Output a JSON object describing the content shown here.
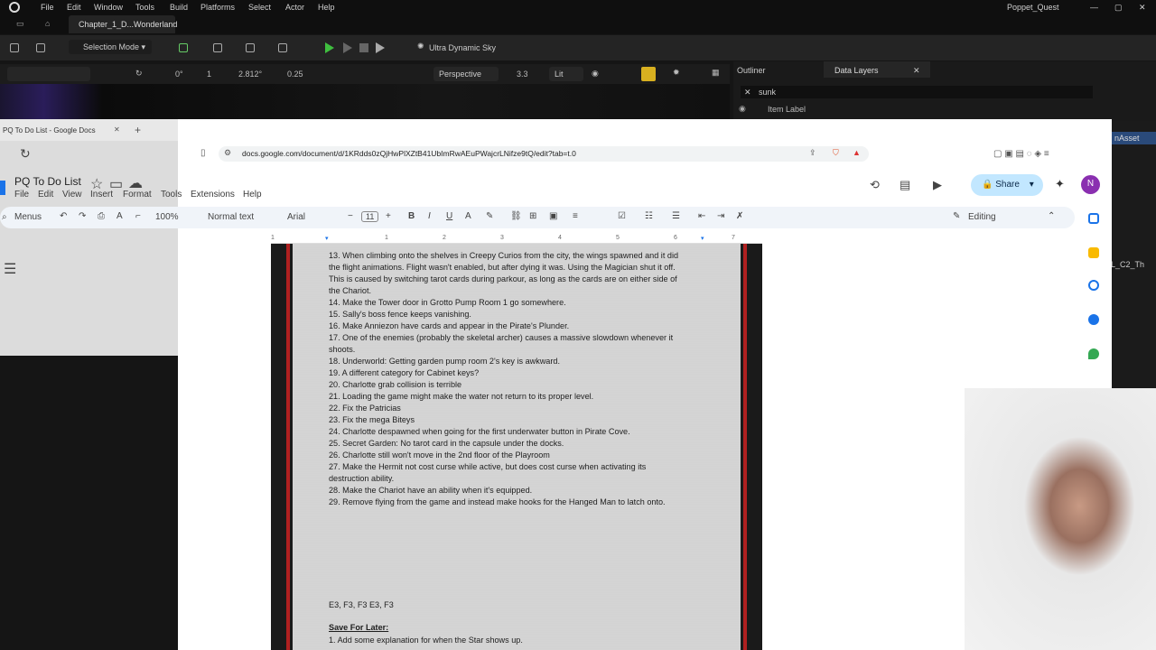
{
  "unreal": {
    "menu": [
      "File",
      "Edit",
      "Window",
      "Tools",
      "Build",
      "Platforms",
      "Select",
      "Actor",
      "Help"
    ],
    "project_name": "Poppet_Quest",
    "level_tab": "Chapter_1_D...Wonderland",
    "selection_mode": "Selection Mode",
    "sky_label": "Ultra Dynamic Sky",
    "viewport": {
      "perspective": "Perspective",
      "lit": "Lit",
      "angle": "2.812°",
      "scale": "0.25",
      "speed": "3.3",
      "snap_count": "1",
      "rot": "0°"
    },
    "outliner_tab": "Outliner",
    "data_layers_tab": "Data Layers",
    "search_value": "sunk",
    "item_label_header": "Item Label",
    "right_panel_text": "nAsset",
    "side_text": "L_C2_Th"
  },
  "browser": {
    "tab_title": "PQ To Do List - Google Docs",
    "url": "docs.google.com/document/d/1KRdds0zQjHwPlXZtB41UbImRwAEuPWajcrLNifze9tQ/edit?tab=t.0",
    "doc_title": "PQ To Do List",
    "menu": [
      "File",
      "Edit",
      "View",
      "Insert",
      "Format",
      "Tools",
      "Extensions",
      "Help"
    ],
    "toolbar": {
      "menus": "Menus",
      "zoom": "100%",
      "style": "Normal text",
      "font": "Arial",
      "size": "11",
      "editing": "Editing",
      "share": "Share",
      "avatar": "N"
    },
    "ruler_marks": [
      "1",
      "1",
      "2",
      "3",
      "4",
      "5",
      "6",
      "7"
    ]
  },
  "doc": {
    "lines": [
      "13. When climbing onto the shelves in Creepy Curios from the city, the wings spawned and it did",
      "the flight animations. Flight wasn't enabled, but after dying it was. Using the Magician shut it off.",
      "This is caused by switching tarot cards during parkour, as long as the cards are on either side of",
      "the Chariot.",
      "14. Make the Tower door in Grotto Pump Room 1 go somewhere.",
      "15. Sally's boss fence keeps vanishing.",
      "16. Make Anniezon have cards and appear in the Pirate's Plunder.",
      "17. One of the enemies (probably the skeletal archer) causes a massive slowdown whenever it",
      "shoots.",
      "18. Underworld: Getting garden pump room 2's key is awkward.",
      "19. A different category for Cabinet keys?",
      "20. Charlotte grab collision is terrible",
      "21. Loading the game might make the water not return to its proper level.",
      "22. Fix the Patricias",
      "23. Fix the mega Biteys",
      "24. Charlotte despawned when going for the first underwater button in Pirate Cove.",
      "25. Secret Garden: No tarot card in the capsule under the docks.",
      "26. Charlotte still won't move in the 2nd floor of the Playroom",
      "27. Make the Hermit not cost curse while active, but does cost curse when activating its",
      "destruction ability.",
      "28. Make the Chariot have an ability when it's equipped.",
      "29. Remove flying from the game and instead make hooks for the Hanged Man to latch onto."
    ],
    "keys_line": "E3, F3,  F3  E3, F3",
    "save_heading": "Save For Later:",
    "save_line1": "1. Add some explanation for when the Star shows up."
  }
}
